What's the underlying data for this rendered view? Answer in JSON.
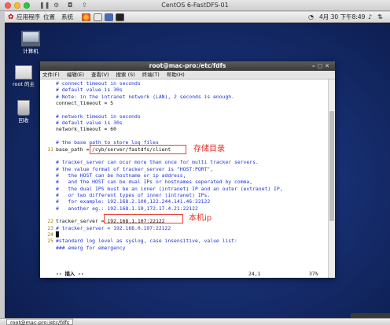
{
  "mac": {
    "window_title": "CentOS 6-FastDFS-01"
  },
  "panel": {
    "menus": [
      "应用程序",
      "位置",
      "系统"
    ],
    "datetime": "4月 30 下午8:49"
  },
  "desktop_icons": [
    {
      "label": "计算机"
    },
    {
      "label": "root 的主"
    },
    {
      "label": "回收"
    }
  ],
  "terminal": {
    "title": "root@mac-pro:/etc/fdfs",
    "menu": [
      "文件(F)",
      "编辑(E)",
      "查看(V)",
      "搜索 (S)",
      "终端(T)",
      "帮助(H)"
    ],
    "lines": [
      {
        "n": "",
        "t": "# connect timeout in seconds",
        "cls": "c"
      },
      {
        "n": "",
        "t": "# default value is 30s",
        "cls": "c"
      },
      {
        "n": "",
        "t": "# Note: in the intranet network (LAN), 2 seconds is enough.",
        "cls": "c"
      },
      {
        "n": "",
        "t": "connect_timeout = 5",
        "cls": "n"
      },
      {
        "n": "",
        "t": "",
        "cls": "n"
      },
      {
        "n": "",
        "t": "# network timeout in seconds",
        "cls": "c"
      },
      {
        "n": "",
        "t": "# default value is 30s",
        "cls": "c"
      },
      {
        "n": "",
        "t": "network_timeout = 60",
        "cls": "n"
      },
      {
        "n": "",
        "t": "",
        "cls": "n"
      },
      {
        "n": "",
        "t": "# the base path to store log files",
        "cls": "c"
      },
      {
        "n": "11",
        "t": "base_path = /cyb/server/fastdfs/client",
        "cls": "n"
      },
      {
        "n": "",
        "t": "",
        "cls": "n"
      },
      {
        "n": "",
        "t": "# tracker_server can ocur more than once for multi tracker servers.",
        "cls": "c"
      },
      {
        "n": "",
        "t": "# the value format of tracker_server is \"HOST:PORT\",",
        "cls": "c"
      },
      {
        "n": "",
        "t": "#   the HOST can be hostname or ip address,",
        "cls": "c"
      },
      {
        "n": "",
        "t": "#   and the HOST can be dual IPs or hostnames seperated by comma,",
        "cls": "c"
      },
      {
        "n": "",
        "t": "#   the dual IPS must be an inner (intranet) IP and an outer (extranet) IP,",
        "cls": "c"
      },
      {
        "n": "",
        "t": "#   or two different types of inner (intranet) IPs.",
        "cls": "c"
      },
      {
        "n": "",
        "t": "#   for example: 192.168.2.100,122.244.141.46:22122",
        "cls": "c"
      },
      {
        "n": "",
        "t": "#   another eg.: 192.168.1.10,172.17.4.21:22122",
        "cls": "c"
      },
      {
        "n": "",
        "t": "",
        "cls": "n"
      },
      {
        "n": "22",
        "t": "tracker_server = 192.168.1.107:22122",
        "cls": "n"
      },
      {
        "n": "23",
        "t": "# tracker_server = 192.168.0.197:22122",
        "cls": "c"
      },
      {
        "n": "24",
        "t": "█",
        "cls": "n"
      },
      {
        "n": "25",
        "t": "#standard log level as syslog, case insensitive, value list:",
        "cls": "c"
      },
      {
        "n": "",
        "t": "### emerg for emergency",
        "cls": "c"
      }
    ],
    "status_mode": "-- 插入 --",
    "status_pos": "24,1",
    "status_pct": "37%"
  },
  "annotations": {
    "storage_dir": "存储目录",
    "local_ip": "本机ip"
  },
  "taskbar": {
    "item": "root@mac-pro:/etc/fdfs"
  },
  "colors": {
    "annotation": "#e8423a",
    "comment": "#1e35d8"
  }
}
